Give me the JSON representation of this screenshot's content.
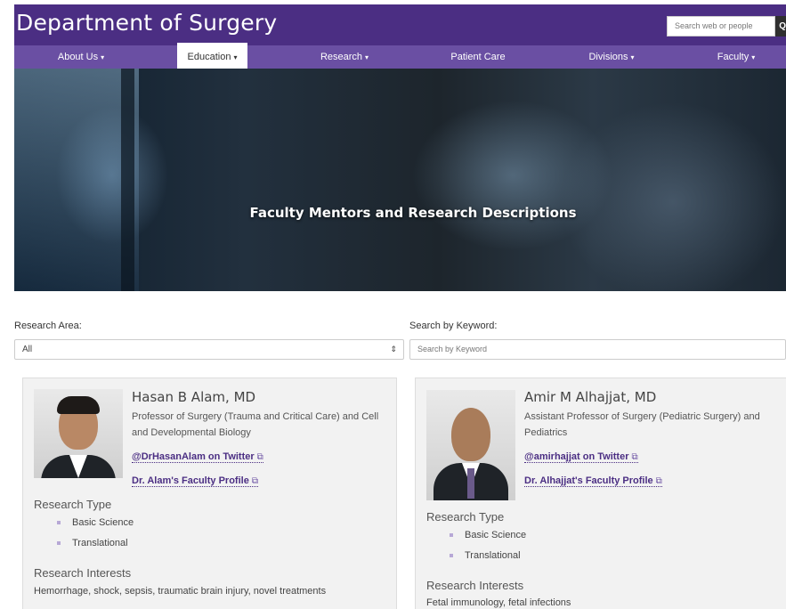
{
  "header": {
    "site_title": "Department of Surgery",
    "search_placeholder": "Search web or people",
    "search_button_glyph": "Q"
  },
  "nav": {
    "items": [
      {
        "label": "About Us",
        "dropdown": true
      },
      {
        "label": "Education",
        "dropdown": true,
        "active": true
      },
      {
        "label": "Research",
        "dropdown": true
      },
      {
        "label": "Patient Care",
        "dropdown": false
      },
      {
        "label": "Divisions",
        "dropdown": true
      },
      {
        "label": "Faculty",
        "dropdown": true
      }
    ],
    "caret": "▾"
  },
  "hero": {
    "title": "Faculty Mentors and Research Descriptions"
  },
  "filters": {
    "research_area_label": "Research Area:",
    "research_area_value": "All",
    "keyword_label": "Search by Keyword:",
    "keyword_placeholder": "Search by Keyword",
    "select_arrow": "⇕"
  },
  "faculty": [
    {
      "name": "Hasan B Alam, MD",
      "title": "Professor of Surgery (Trauma and Critical Care) and Cell and Developmental Biology",
      "twitter_link": "@DrHasanAlam on Twitter",
      "profile_link": "Dr. Alam's Faculty Profile",
      "research_type_label": "Research Type",
      "research_types": [
        "Basic Science",
        "Translational"
      ],
      "interests_label": "Research Interests",
      "interests": "Hemorrhage, shock, sepsis, traumatic brain injury, novel treatments"
    },
    {
      "name": "Amir M Alhajjat, MD",
      "title": "Assistant Professor of Surgery (Pediatric Surgery) and Pediatrics",
      "twitter_link": "@amirhajjat on Twitter",
      "profile_link": "Dr. Alhajjat's Faculty Profile",
      "research_type_label": "Research Type",
      "research_types": [
        "Basic Science",
        "Translational"
      ],
      "interests_label": "Research Interests",
      "interests": "Fetal immunology, fetal infections"
    }
  ],
  "icons": {
    "external_link": "⧉"
  },
  "colors": {
    "brand_purple": "#4b2e83",
    "nav_purple": "#6a4fa3"
  }
}
